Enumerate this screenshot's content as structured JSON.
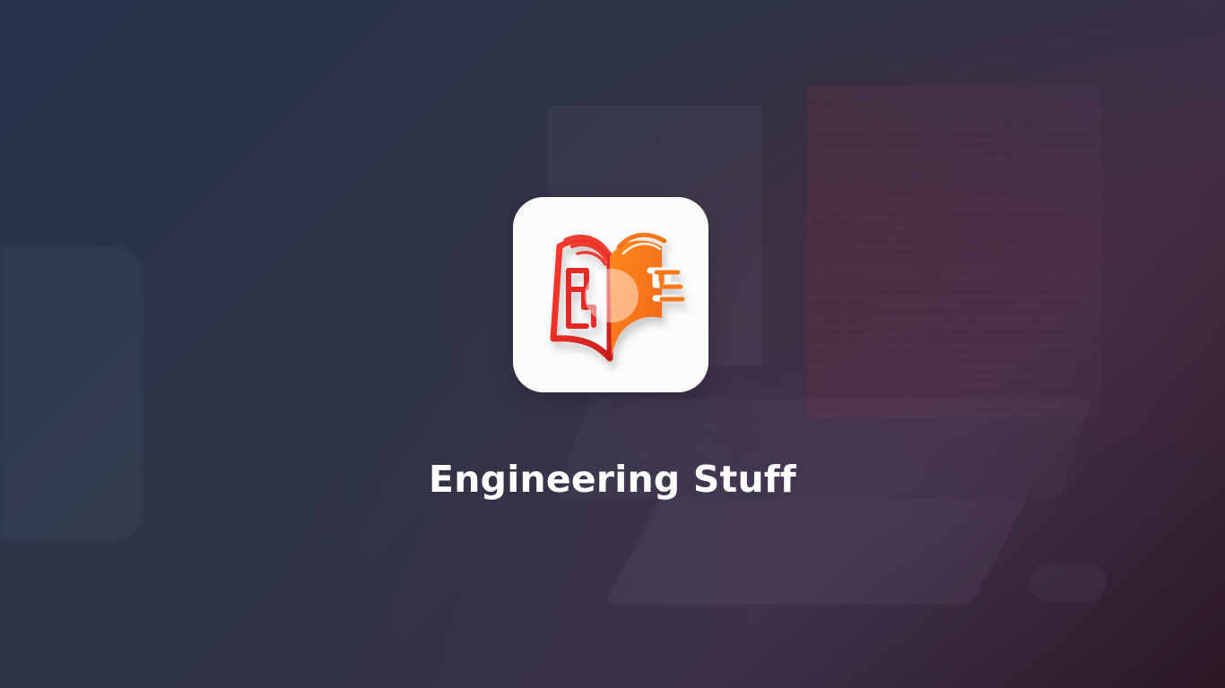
{
  "splash": {
    "title": "Engineering Stuff",
    "logo_icon": "open-book-logo-icon",
    "colors": {
      "background": "#2a3142",
      "title": "#ffffff",
      "icon_tile": "#fbfbfb",
      "logo_red": "#e3342d",
      "logo_orange": "#f7831f"
    }
  }
}
